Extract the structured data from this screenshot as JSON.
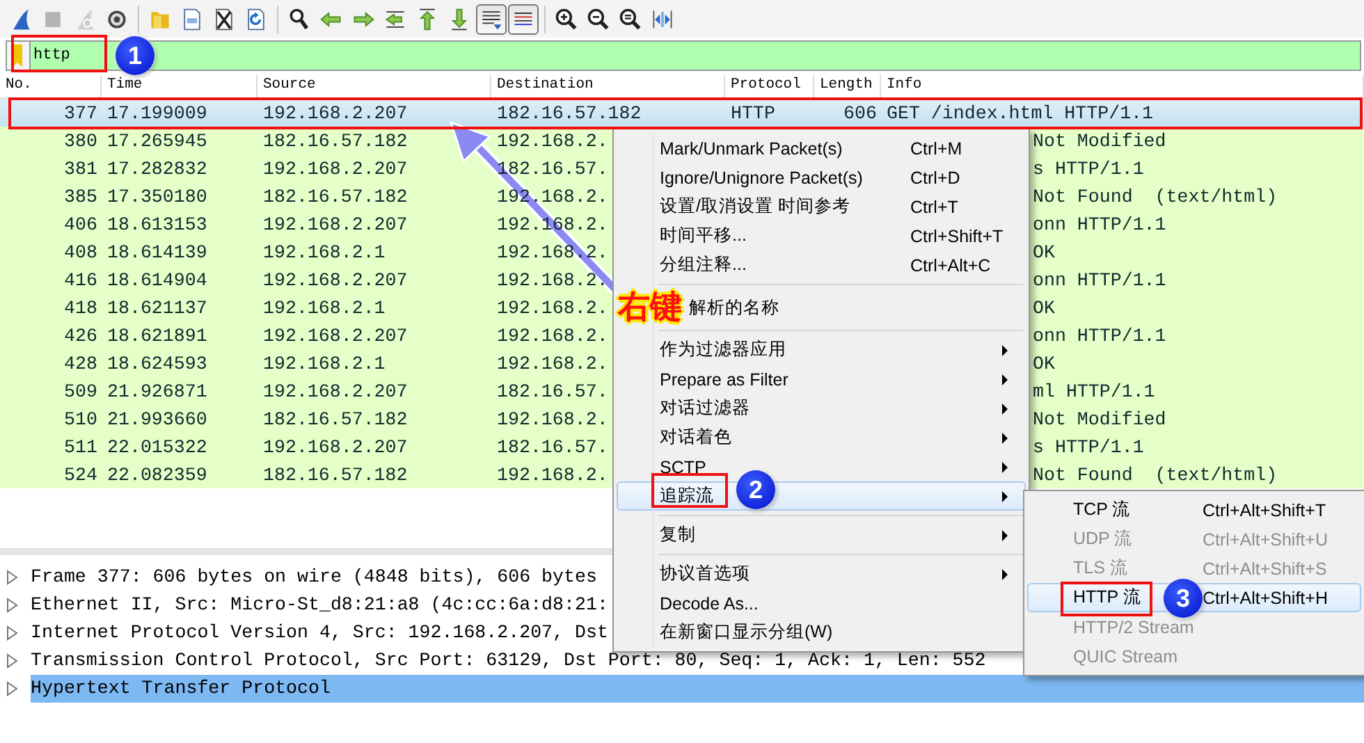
{
  "toolbar": {
    "groups": [
      [
        {
          "kind": "start",
          "disabled": false,
          "pressed": false
        },
        {
          "kind": "stop",
          "disabled": true,
          "pressed": false
        },
        {
          "kind": "restart",
          "disabled": true,
          "pressed": false
        },
        {
          "kind": "options",
          "disabled": false,
          "pressed": false
        }
      ],
      [
        {
          "kind": "open",
          "disabled": false,
          "pressed": false
        },
        {
          "kind": "save",
          "disabled": false,
          "pressed": false
        },
        {
          "kind": "close",
          "disabled": false,
          "pressed": false
        },
        {
          "kind": "reload",
          "disabled": false,
          "pressed": false
        }
      ],
      [
        {
          "kind": "find",
          "disabled": false,
          "pressed": false
        },
        {
          "kind": "back",
          "disabled": false,
          "pressed": false
        },
        {
          "kind": "forward",
          "disabled": false,
          "pressed": false
        },
        {
          "kind": "goto",
          "disabled": false,
          "pressed": false
        },
        {
          "kind": "first",
          "disabled": false,
          "pressed": false
        },
        {
          "kind": "last",
          "disabled": false,
          "pressed": false
        },
        {
          "kind": "autoscroll",
          "disabled": false,
          "pressed": true
        },
        {
          "kind": "colorize",
          "disabled": false,
          "pressed": true
        }
      ],
      [
        {
          "kind": "zoom_in",
          "disabled": false,
          "pressed": false
        },
        {
          "kind": "zoom_out",
          "disabled": false,
          "pressed": false
        },
        {
          "kind": "zoom_reset",
          "disabled": false,
          "pressed": false
        },
        {
          "kind": "resize",
          "disabled": false,
          "pressed": false
        }
      ]
    ]
  },
  "filter": {
    "value": "http"
  },
  "packet_list": {
    "columns": [
      "No.",
      "Time",
      "Source",
      "Destination",
      "Protocol",
      "Length",
      "Info"
    ],
    "rows": [
      {
        "no": "377",
        "time": "17.199009",
        "source": "192.168.2.207",
        "destination": "182.16.57.182",
        "protocol": "HTTP",
        "length": "606",
        "info": "GET /index.html HTTP/1.1",
        "selected": true
      },
      {
        "no": "380",
        "time": "17.265945",
        "source": "182.16.57.182",
        "destination": "192.168.2.",
        "info": "Not Modified",
        "selected": false
      },
      {
        "no": "381",
        "time": "17.282832",
        "source": "192.168.2.207",
        "destination": "182.16.57.",
        "info": "s HTTP/1.1",
        "selected": false
      },
      {
        "no": "385",
        "time": "17.350180",
        "source": "182.16.57.182",
        "destination": "192.168.2.",
        "info": "Not Found  (text/html)",
        "selected": false
      },
      {
        "no": "406",
        "time": "18.613153",
        "source": "192.168.2.207",
        "destination": "192.168.2.",
        "info": "onn HTTP/1.1",
        "selected": false
      },
      {
        "no": "408",
        "time": "18.614139",
        "source": "192.168.2.1",
        "destination": "192.168.2.",
        "info": "OK",
        "selected": false
      },
      {
        "no": "416",
        "time": "18.614904",
        "source": "192.168.2.207",
        "destination": "192.168.2.",
        "info": "onn HTTP/1.1",
        "selected": false
      },
      {
        "no": "418",
        "time": "18.621137",
        "source": "192.168.2.1",
        "destination": "192.168.2.",
        "info": "OK",
        "selected": false
      },
      {
        "no": "426",
        "time": "18.621891",
        "source": "192.168.2.207",
        "destination": "192.168.2.",
        "info": "onn HTTP/1.1",
        "selected": false
      },
      {
        "no": "428",
        "time": "18.624593",
        "source": "192.168.2.1",
        "destination": "192.168.2.",
        "info": "OK",
        "selected": false
      },
      {
        "no": "509",
        "time": "21.926871",
        "source": "192.168.2.207",
        "destination": "182.16.57.",
        "info": "ml HTTP/1.1",
        "selected": false
      },
      {
        "no": "510",
        "time": "21.993660",
        "source": "182.16.57.182",
        "destination": "192.168.2.",
        "info": "Not Modified",
        "selected": false
      },
      {
        "no": "511",
        "time": "22.015322",
        "source": "192.168.2.207",
        "destination": "182.16.57.",
        "info": "s HTTP/1.1",
        "selected": false
      },
      {
        "no": "524",
        "time": "22.082359",
        "source": "182.16.57.182",
        "destination": "192.168.2.",
        "info": "Not Found  (text/html)",
        "selected": false
      }
    ]
  },
  "details": [
    {
      "text": "Frame 377: 606 bytes on wire (4848 bits), 606 bytes",
      "selected": false
    },
    {
      "text": "Ethernet II, Src: Micro-St_d8:21:a8 (4c:cc:6a:d8:21:",
      "selected": false
    },
    {
      "text": "Internet Protocol Version 4, Src: 192.168.2.207, Dst",
      "selected": false
    },
    {
      "text": "Transmission Control Protocol, Src Port: 63129, Dst Port: 80, Seq: 1, Ack: 1, Len: 552",
      "selected": false
    },
    {
      "text": "Hypertext Transfer Protocol",
      "selected": true
    }
  ],
  "context_menu": [
    {
      "kind": "item",
      "label": "Mark/Unmark Packet(s)",
      "shortcut": "Ctrl+M",
      "submenu": false,
      "selected": false
    },
    {
      "kind": "item",
      "label": "Ignore/Unignore Packet(s)",
      "shortcut": "Ctrl+D",
      "submenu": false,
      "selected": false
    },
    {
      "kind": "item",
      "label": "设置/取消设置 时间参考",
      "shortcut": "Ctrl+T",
      "submenu": false,
      "selected": false
    },
    {
      "kind": "item",
      "label": "时间平移...",
      "shortcut": "Ctrl+Shift+T",
      "submenu": false,
      "selected": false
    },
    {
      "kind": "item",
      "label": "分组注释...",
      "shortcut": "Ctrl+Alt+C",
      "submenu": false,
      "selected": false
    },
    {
      "kind": "separator"
    },
    {
      "kind": "item",
      "label": "解析的名称",
      "submenu": false,
      "selected": false
    },
    {
      "kind": "separator"
    },
    {
      "kind": "item",
      "label": "作为过滤器应用",
      "submenu": true,
      "selected": false
    },
    {
      "kind": "item",
      "label": "Prepare as Filter",
      "submenu": true,
      "selected": false
    },
    {
      "kind": "item",
      "label": "对话过滤器",
      "submenu": true,
      "selected": false
    },
    {
      "kind": "item",
      "label": "对话着色",
      "submenu": true,
      "selected": false
    },
    {
      "kind": "item",
      "label": "SCTP",
      "submenu": true,
      "selected": false
    },
    {
      "kind": "item",
      "label": "追踪流",
      "submenu": true,
      "selected": true
    },
    {
      "kind": "separator"
    },
    {
      "kind": "item",
      "label": "复制",
      "submenu": true,
      "selected": false
    },
    {
      "kind": "separator"
    },
    {
      "kind": "item",
      "label": "协议首选项",
      "submenu": true,
      "selected": false
    },
    {
      "kind": "item",
      "label": "Decode As...",
      "submenu": false,
      "selected": false
    },
    {
      "kind": "item",
      "label": "在新窗口显示分组(W)",
      "submenu": false,
      "selected": false
    }
  ],
  "submenu": [
    {
      "label": "TCP 流",
      "shortcut": "Ctrl+Alt+Shift+T",
      "disabled": false,
      "selected": false
    },
    {
      "label": "UDP 流",
      "shortcut": "Ctrl+Alt+Shift+U",
      "disabled": true,
      "selected": false
    },
    {
      "label": "TLS 流",
      "shortcut": "Ctrl+Alt+Shift+S",
      "disabled": true,
      "selected": false
    },
    {
      "label": "HTTP 流",
      "shortcut": "Ctrl+Alt+Shift+H",
      "disabled": false,
      "selected": true
    },
    {
      "label": "HTTP/2 Stream",
      "disabled": true,
      "selected": false
    },
    {
      "label": "QUIC Stream",
      "disabled": true,
      "selected": false
    }
  ],
  "annotations": {
    "badges": [
      "1",
      "2",
      "3"
    ],
    "callout": "右键"
  }
}
